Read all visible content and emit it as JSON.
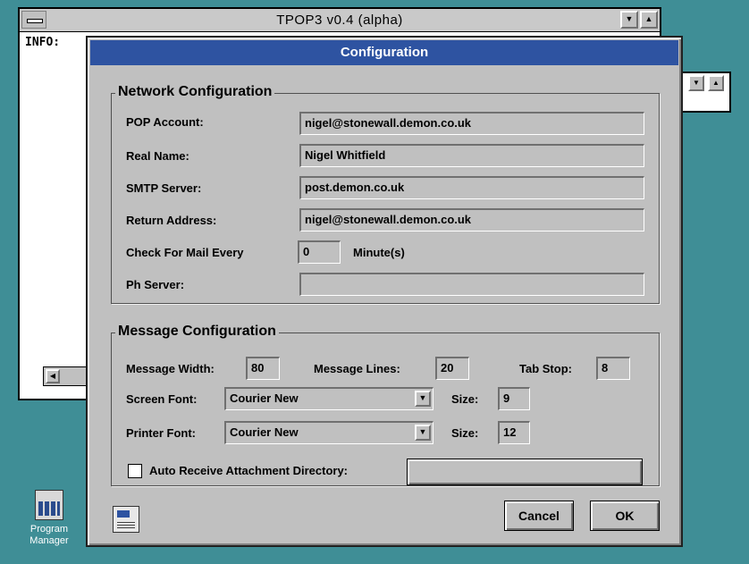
{
  "main_window": {
    "title": "TPOP3 v0.4 (alpha)",
    "info_label": "INFO:"
  },
  "desktop": {
    "program_manager_label_line1": "Program",
    "program_manager_label_line2": "Manager"
  },
  "dialog": {
    "title": "Configuration",
    "network": {
      "group_title": "Network Configuration",
      "pop_account_label": "POP Account:",
      "pop_account_value": "nigel@stonewall.demon.co.uk",
      "real_name_label": "Real Name:",
      "real_name_value": "Nigel Whitfield",
      "smtp_server_label": "SMTP Server:",
      "smtp_server_value": "post.demon.co.uk",
      "return_address_label": "Return Address:",
      "return_address_value": "nigel@stonewall.demon.co.uk",
      "check_mail_label": "Check For Mail Every",
      "check_mail_value": "0",
      "check_mail_unit": "Minute(s)",
      "ph_server_label": "Ph Server:",
      "ph_server_value": ""
    },
    "message": {
      "group_title": "Message Configuration",
      "width_label": "Message Width:",
      "width_value": "80",
      "lines_label": "Message Lines:",
      "lines_value": "20",
      "tab_stop_label": "Tab Stop:",
      "tab_stop_value": "8",
      "screen_font_label": "Screen Font:",
      "screen_font_value": "Courier New",
      "screen_size_label": "Size:",
      "screen_size_value": "9",
      "printer_font_label": "Printer Font:",
      "printer_font_value": "Courier New",
      "printer_size_label": "Size:",
      "printer_size_value": "12",
      "auto_receive_label": "Auto Receive Attachment Directory:",
      "auto_receive_checked": false
    },
    "buttons": {
      "cancel": "Cancel",
      "ok": "OK"
    }
  },
  "colors": {
    "desktop": "#3f8e96",
    "dialog_titlebar": "#2e53a1",
    "face": "#c0c0c0"
  }
}
